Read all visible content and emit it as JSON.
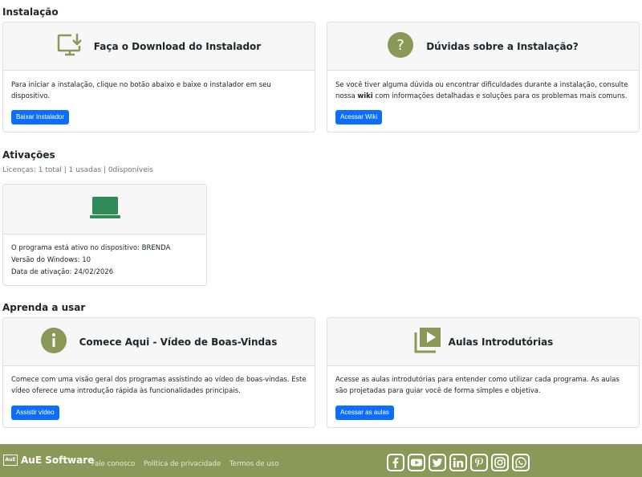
{
  "install": {
    "title": "Instalação",
    "download": {
      "title": "Faça o Download do Instalador",
      "body": "Para iniciar a instalação, clique no botão abaixo e baixe o instalador em seu dispositivo.",
      "button": "Baixar Instalador"
    },
    "help": {
      "title": "Dúvidas sobre a Instalação?",
      "body_before": "Se você tiver alguma dúvida ou encontrar dificuldades durante a instalação, consulte nossa ",
      "body_bold": "wiki",
      "body_after": " com informações detalhadas e soluções para os problemas mais comuns.",
      "button": "Acessar Wiki"
    }
  },
  "activations": {
    "title": "Ativações",
    "licenses": "Licenças: 1 total | 1 usadas | 0disponíveis",
    "device": {
      "line1": "O programa está ativo no dispositivo: BRENDA",
      "line2": "Versão do Windows: 10",
      "line3": "Data de ativação: 24/02/2026"
    }
  },
  "learn": {
    "title": "Aprenda a usar",
    "start": {
      "title": "Comece Aqui - Vídeo de Boas-Vindas",
      "body": "Comece com uma visão geral dos programas assistindo ao vídeo de boas-vindas. Este vídeo oferece uma introdução rápida às funcionalidades principais.",
      "button": "Assistir vídeo"
    },
    "lessons": {
      "title": "Aulas Introdutórias",
      "body": "Acesse as aulas introdutórias para entender como utilizar cada programa. As aulas são projetadas para guiar você de forma simples e objetiva.",
      "button": "Acessar as aulas"
    }
  },
  "footer": {
    "brand": "AuE Software",
    "logo_text": "AuE",
    "links": [
      "Fale conosco",
      "Política de privacidade",
      "Termos de uso"
    ],
    "social_icons": [
      "facebook-icon",
      "youtube-icon",
      "twitter-icon",
      "linkedin-icon",
      "pinterest-icon",
      "instagram-icon",
      "whatsapp-icon"
    ]
  },
  "colors": {
    "accent_green": "#8a9957",
    "button_blue": "#0d6efd",
    "laptop_green": "#2e8b57"
  }
}
